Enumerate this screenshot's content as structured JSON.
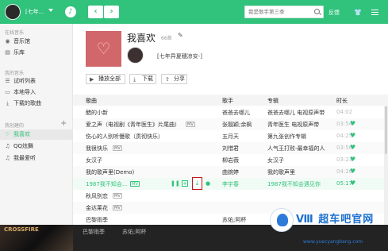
{
  "topbar": {
    "user": "[七年...",
    "search_placeholder": "我是歌手第三季",
    "feedback": "反馈",
    "skin_icon": "shirt-icon",
    "back": "‹",
    "forward": "›"
  },
  "sidebar": {
    "sections": [
      "在线音乐",
      "我的音乐",
      "我创建的"
    ],
    "online": [
      {
        "label": "音乐馆",
        "icon": "disc-icon"
      },
      {
        "label": "乐库",
        "icon": "library-icon"
      }
    ],
    "mine": [
      {
        "label": "试听列表",
        "icon": "list-icon"
      },
      {
        "label": "本地导入",
        "icon": "monitor-icon"
      },
      {
        "label": "下载的歌曲",
        "icon": "download-icon"
      }
    ],
    "created": [
      {
        "label": "我喜欢",
        "icon": "heart-icon",
        "active": true
      },
      {
        "label": "QQ炫舞",
        "icon": "note-icon"
      },
      {
        "label": "我最爱听",
        "icon": "note-icon"
      }
    ],
    "add": "+"
  },
  "playlist": {
    "title": "我喜欢",
    "count": "66首",
    "owner": "[七年异夏穗凉安-]",
    "actions": [
      "播放全部",
      "下载",
      "分享"
    ]
  },
  "table": {
    "headers": [
      "歌曲",
      "歌手",
      "专辑",
      "时长"
    ],
    "rows": [
      {
        "song": "醋的小新",
        "artist": "爸爸去哪儿",
        "album": "爸爸去哪儿 电视原声带",
        "time": "04:02",
        "mv": ""
      },
      {
        "song": "爱之声（电视剧《青年医生》片尾曲）",
        "artist": "张靓颖;余枫",
        "album": "青年医生 电视原声带",
        "time": "03:54",
        "mv": "MV"
      },
      {
        "song": "伤心的人别听慢歌（贯彻快乐）",
        "artist": "五月天",
        "album": "第九张创作专辑",
        "time": "04:25",
        "mv": ""
      },
      {
        "song": "我很快乐",
        "artist": "刘惜君",
        "album": "人气王打败-最幸福的人",
        "time": "03:56",
        "mv": "MV"
      },
      {
        "song": "女汉子",
        "artist": "柳岩薇",
        "album": "女汉子",
        "time": "03:23",
        "mv": ""
      },
      {
        "song": "我的歌声里(Demo)",
        "artist": "曲婉婷",
        "album": "我的歌声里",
        "time": "04:26",
        "mv": ""
      },
      {
        "song": "1987我不知会...",
        "artist": "李宇春",
        "album": "1987我不知会遇见你",
        "time": "05:17",
        "mv": "MV"
      },
      {
        "song": "秋风别恋",
        "artist": "",
        "album": "",
        "time": "",
        "mv": "MV"
      },
      {
        "song": "金达莱花",
        "artist": "",
        "album": "",
        "time": "",
        "mv": "MV"
      },
      {
        "song": "巴黎雨季",
        "artist": "苏佑;阿杯",
        "album": "",
        "time": "",
        "mv": ""
      }
    ]
  },
  "bottom": {
    "promo": "CROSSFIRE",
    "song": "巴黎雨季",
    "artist": "苏佑;阿杯"
  },
  "watermark": {
    "text": "Ⅷ 超车吧官网",
    "url": "www.yuecyangbang.com"
  }
}
